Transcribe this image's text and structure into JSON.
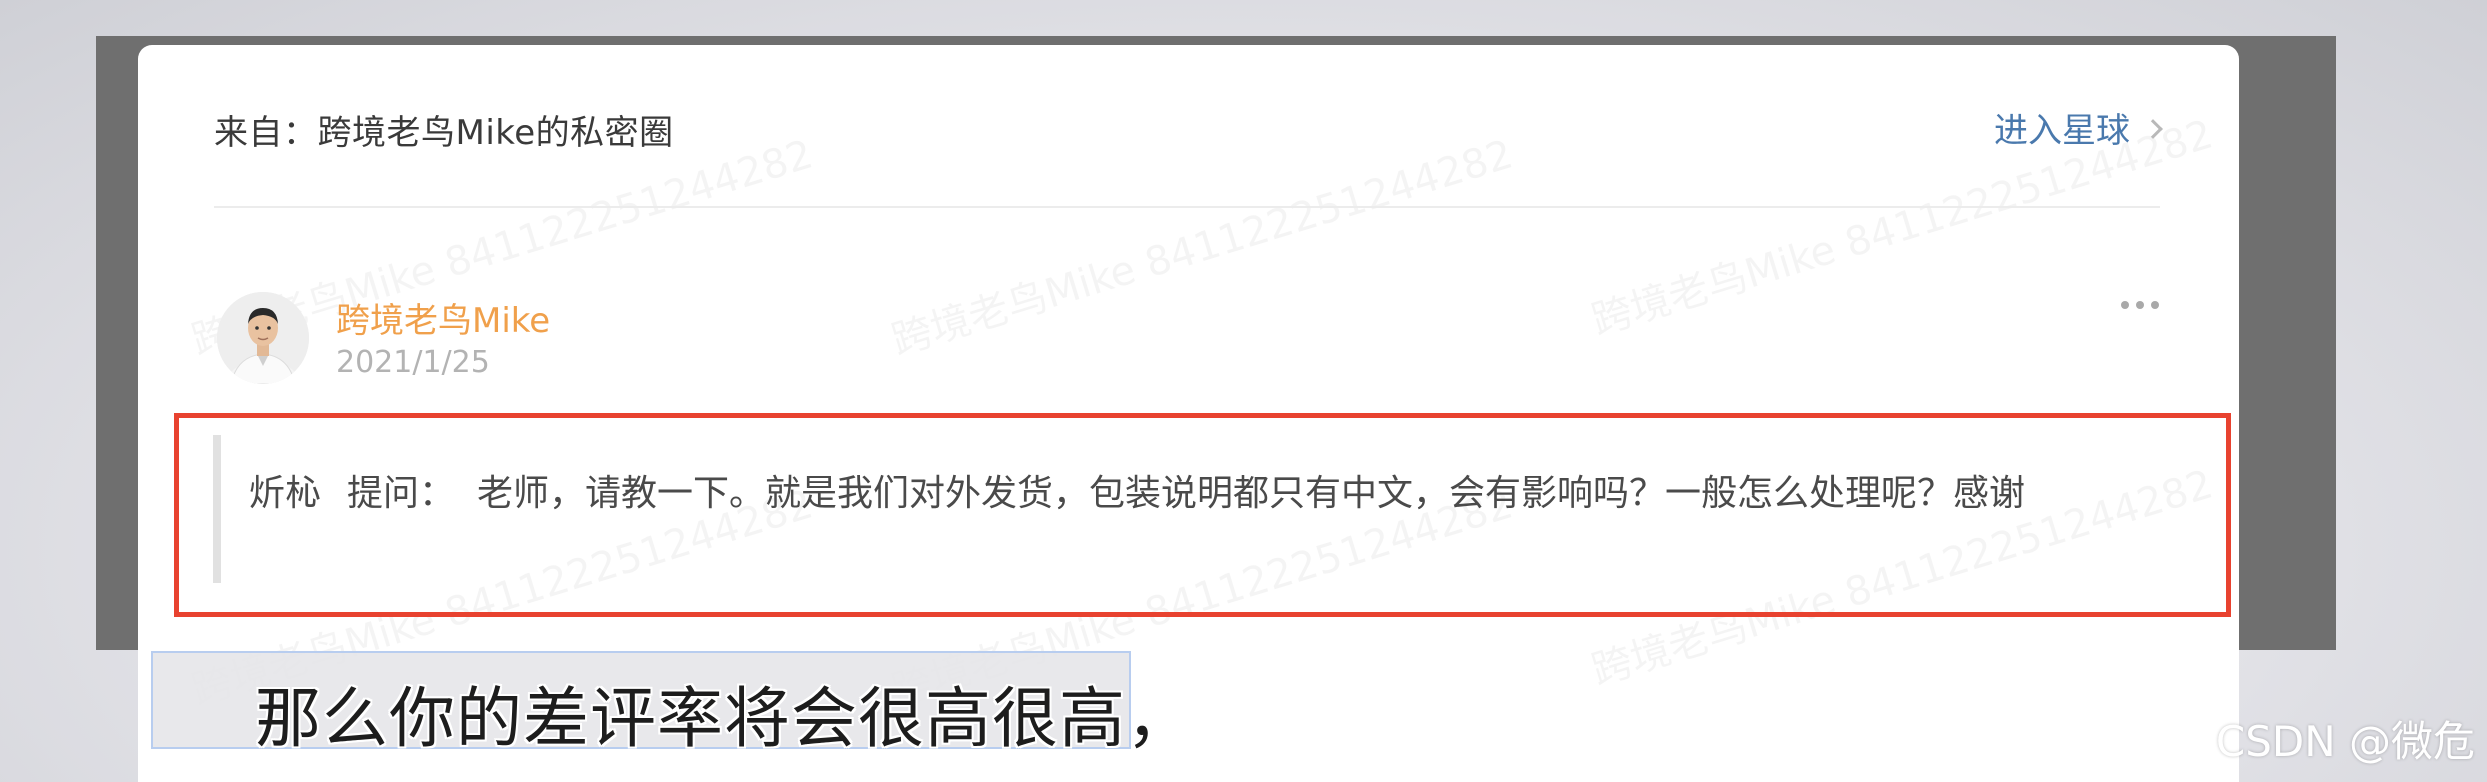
{
  "header": {
    "from_text": "来自：跨境老鸟Mike的私密圈",
    "enter_link": "进入星球"
  },
  "post": {
    "author": "跨境老鸟Mike",
    "date": "2021/1/25",
    "asker": "炘杺",
    "ask_label": "提问：",
    "question": "老师，请教一下。就是我们对外发货，包装说明都只有中文，会有影响吗？一般怎么处理呢？感谢"
  },
  "watermark": "跨境老鸟Mike 841122251244282",
  "subtitle": "那么你的差评率将会很高很高，",
  "credit": "CSDN @微危",
  "colors": {
    "highlight": "#e8422f",
    "author": "#f0a04b",
    "link": "#4a79ad"
  },
  "icons": [
    "chevron-right-icon",
    "more-dots-icon",
    "avatar-image"
  ]
}
